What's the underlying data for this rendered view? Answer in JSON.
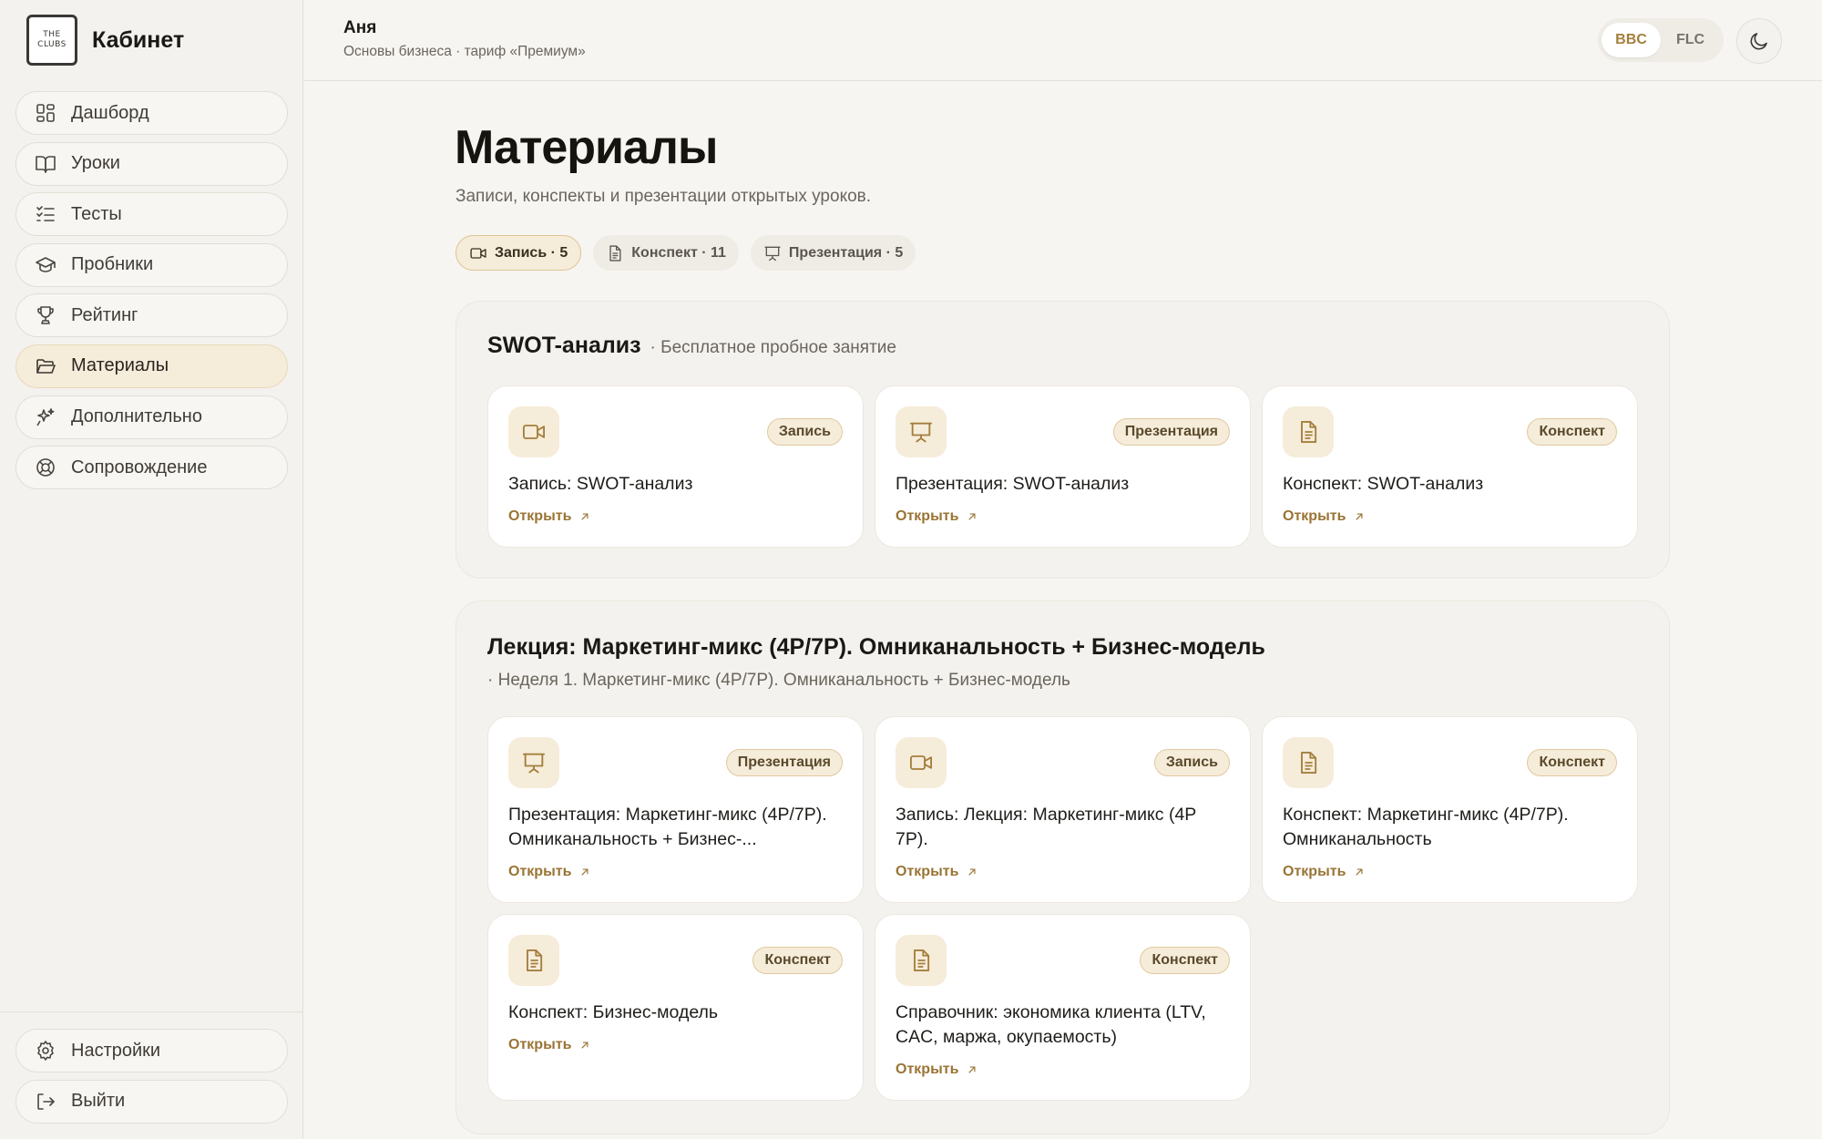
{
  "brand": {
    "logo_line1": "THE",
    "logo_line2": "CLUBS",
    "title": "Кабинет"
  },
  "sidebar": {
    "items": [
      {
        "label": "Дашборд",
        "icon": "dashboard-icon"
      },
      {
        "label": "Уроки",
        "icon": "book-icon"
      },
      {
        "label": "Тесты",
        "icon": "checklist-icon"
      },
      {
        "label": "Пробники",
        "icon": "graduation-cap-icon"
      },
      {
        "label": "Рейтинг",
        "icon": "trophy-icon"
      },
      {
        "label": "Материалы",
        "icon": "folder-icon",
        "active": true
      },
      {
        "label": "Дополнительно",
        "icon": "sparkles-icon"
      },
      {
        "label": "Сопровождение",
        "icon": "lifebuoy-icon"
      }
    ],
    "bottom": [
      {
        "label": "Настройки",
        "icon": "gear-icon"
      },
      {
        "label": "Выйти",
        "icon": "logout-icon"
      }
    ]
  },
  "header": {
    "user_name": "Аня",
    "user_subtitle": "Основы бизнеса · тариф «Премиум»",
    "switch": {
      "option1": "BBC",
      "option2": "FLC",
      "active": "BBC"
    },
    "theme_icon": "moon-icon"
  },
  "main": {
    "title": "Материалы",
    "subtitle": "Записи, конспекты и презентации открытых уроков.",
    "filters": [
      {
        "label": "Запись · 5",
        "icon": "video-icon",
        "active": true
      },
      {
        "label": "Конспект · 11",
        "icon": "document-icon",
        "active": false
      },
      {
        "label": "Презентация · 5",
        "icon": "presentation-icon",
        "active": false
      }
    ],
    "sections": [
      {
        "title": "SWOT-анализ",
        "meta": "· Бесплатное пробное занятие",
        "cards": [
          {
            "badge": "Запись",
            "icon": "video-icon",
            "title": "Запись: SWOT-анализ",
            "open": "Открыть"
          },
          {
            "badge": "Презентация",
            "icon": "presentation-icon",
            "title": "Презентация: SWOT-анализ",
            "open": "Открыть"
          },
          {
            "badge": "Конспект",
            "icon": "document-icon",
            "title": "Конспект: SWOT-анализ",
            "open": "Открыть"
          }
        ]
      },
      {
        "title": "Лекция: Маркетинг-микс (4P/7P). Омниканальность + Бизнес-модель",
        "meta": "· Неделя 1. Маркетинг-микс (4P/7P). Омниканальность + Бизнес-модель",
        "cards": [
          {
            "badge": "Презентация",
            "icon": "presentation-icon",
            "title": "Презентация: Маркетинг-микс (4P/7P). Омниканальность + Бизнес-...",
            "open": "Открыть"
          },
          {
            "badge": "Запись",
            "icon": "video-icon",
            "title": "Запись: Лекция: Маркетинг-микс (4P 7P).",
            "open": "Открыть"
          },
          {
            "badge": "Конспект",
            "icon": "document-icon",
            "title": "Конспект: Маркетинг-микс (4P/7P). Омниканальность",
            "open": "Открыть"
          },
          {
            "badge": "Конспект",
            "icon": "document-icon",
            "title": "Конспект: Бизнес-модель",
            "open": "Открыть"
          },
          {
            "badge": "Конспект",
            "icon": "document-icon",
            "title": "Справочник: экономика клиента (LTV, CAC, маржа, окупаемость)",
            "open": "Открыть"
          }
        ]
      }
    ]
  },
  "colors": {
    "accent": "#9a7434",
    "accent_bg": "#f6ecda",
    "page_bg": "#f7f5f1"
  }
}
